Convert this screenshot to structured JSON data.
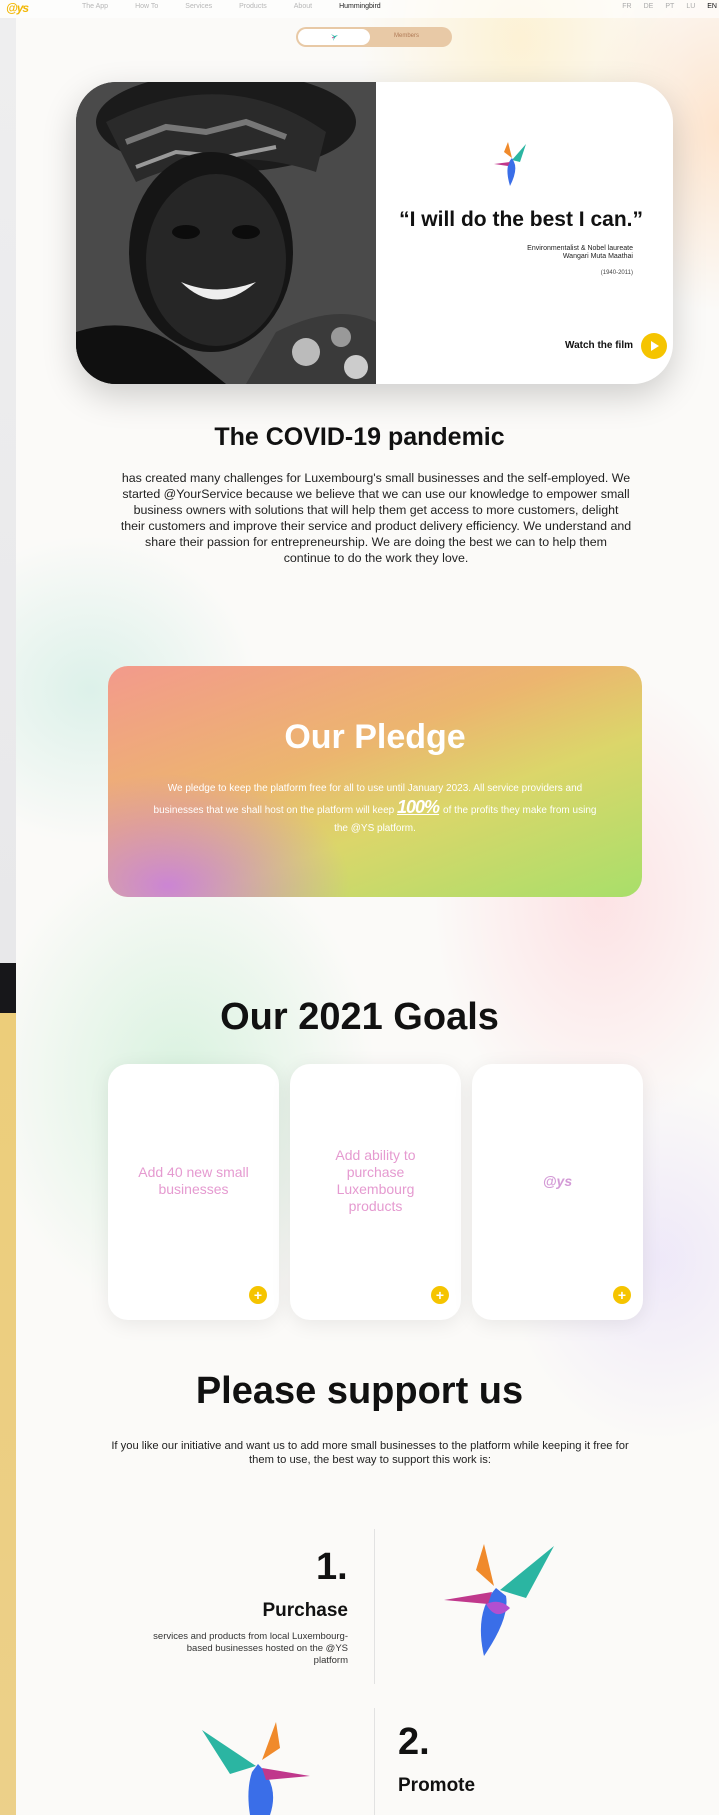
{
  "nav": {
    "logo": "@ys",
    "links": [
      "The App",
      "How To",
      "Services",
      "Products",
      "About",
      "Hummingbird"
    ],
    "languages": [
      "FR",
      "DE",
      "PT",
      "LU",
      "EN"
    ]
  },
  "toggle": {
    "right_label": "Members"
  },
  "hero": {
    "quote": "“I will do the best I can.”",
    "attribution_role": "Environmentalist & Nobel laureate",
    "attribution_name": "Wangari Muta Maathai",
    "years": "(1940-2011)",
    "watch_label": "Watch the film"
  },
  "covid": {
    "title": "The COVID-19 pandemic",
    "body": "has created many challenges for Luxembourg's small businesses and the self-employed. We started @YourService because we believe that we can use our knowledge to empower small business owners with solutions that will help them get access to more customers, delight their customers and improve their service and product delivery efficiency. We understand and share their passion for entrepreneurship. We are doing the best we can to help them continue to do the work they love."
  },
  "pledge": {
    "title": "Our Pledge",
    "line1": "We pledge to keep the platform free for all to use until January 2023. All service providers and businesses that we shall host on the platform will keep",
    "hundred": "100%",
    "line2": "of the profits they make from using the @YS platform."
  },
  "goals": {
    "title": "Our 2021 Goals",
    "cards": [
      {
        "text": "Add 40 new small businesses"
      },
      {
        "text": "Add ability to purchase Luxembourg products"
      },
      {
        "text": "@ys"
      }
    ],
    "plus_symbol": "+"
  },
  "support": {
    "title": "Please support us",
    "body": "If you like our initiative and want us to add more small businesses to the platform while keeping it free for them to use, the best way to support this work is:",
    "steps": [
      {
        "number": "1.",
        "label": "Purchase",
        "desc": "services and products from local Luxembourg-based businesses hosted on the @YS platform"
      },
      {
        "number": "2.",
        "label": "Promote"
      }
    ]
  },
  "colors": {
    "accent": "#f5c400",
    "pink": "#e59ad0",
    "dark": "#111111"
  }
}
